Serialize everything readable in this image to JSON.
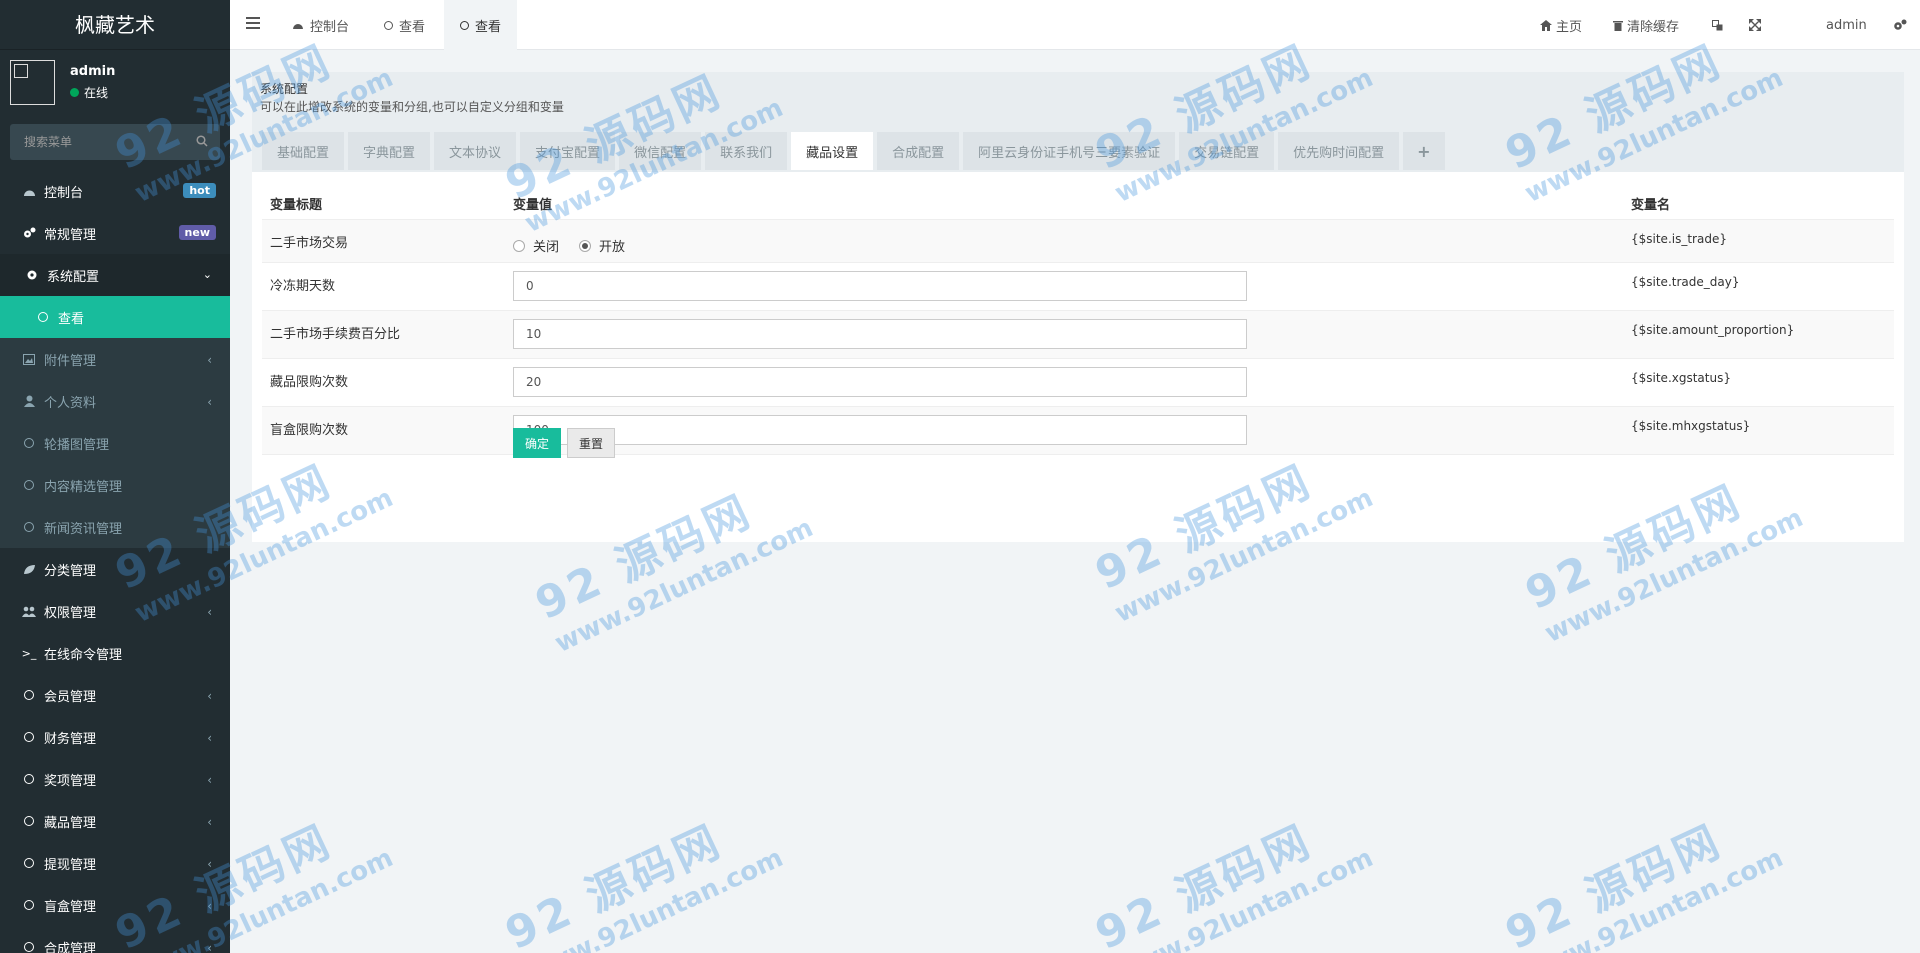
{
  "app": {
    "title": "枫藏艺术"
  },
  "user": {
    "name": "admin",
    "status": "在线"
  },
  "search": {
    "placeholder": "搜索菜单"
  },
  "sidebar": {
    "items": [
      {
        "label": "控制台",
        "badge": "hot"
      },
      {
        "label": "常规管理",
        "badge": "new"
      },
      {
        "label": "系统配置"
      },
      {
        "label": "查看"
      },
      {
        "label": "附件管理"
      },
      {
        "label": "个人资料"
      },
      {
        "label": "轮播图管理"
      },
      {
        "label": "内容精选管理"
      },
      {
        "label": "新闻资讯管理"
      },
      {
        "label": "分类管理"
      },
      {
        "label": "权限管理"
      },
      {
        "label": "在线命令管理"
      },
      {
        "label": "会员管理"
      },
      {
        "label": "财务管理"
      },
      {
        "label": "奖项管理"
      },
      {
        "label": "藏品管理"
      },
      {
        "label": "提现管理"
      },
      {
        "label": "盲盒管理"
      },
      {
        "label": "合成管理"
      }
    ]
  },
  "header": {
    "tabs": [
      {
        "label": "控制台"
      },
      {
        "label": "查看"
      },
      {
        "label": "查看"
      }
    ],
    "home": "主页",
    "clear_cache": "清除缓存",
    "user": "admin"
  },
  "panel": {
    "title": "系统配置",
    "description": "可以在此增改系统的变量和分组,也可以自定义分组和变量",
    "tabs": [
      "基础配置",
      "字典配置",
      "文本协议",
      "支付宝配置",
      "微信配置",
      "联系我们",
      "藏品设置",
      "合成配置",
      "阿里云身份证手机号三要素验证",
      "交易链配置",
      "优先购时间配置"
    ],
    "active_tab": "藏品设置",
    "add_tab_symbol": "+"
  },
  "table": {
    "headers": {
      "title": "变量标题",
      "value": "变量值",
      "name": "变量名"
    },
    "rows": [
      {
        "title": "二手市场交易",
        "var": "{$site.is_trade}",
        "radio_off": "关闭",
        "radio_on": "开放",
        "selected": "开放"
      },
      {
        "title": "冷冻期天数",
        "value": "0",
        "var": "{$site.trade_day}"
      },
      {
        "title": "二手市场手续费百分比",
        "value": "10",
        "var": "{$site.amount_proportion}"
      },
      {
        "title": "藏品限购次数",
        "value": "20",
        "var": "{$site.xgstatus}"
      },
      {
        "title": "盲盒限购次数",
        "value": "100",
        "var": "{$site.mhxgstatus}"
      }
    ]
  },
  "buttons": {
    "submit": "确定",
    "reset": "重置"
  },
  "watermark": {
    "text": "92 源码网",
    "url": "www.92luntan.com"
  },
  "colors": {
    "sidebar_bg": "#222d32",
    "accent": "#18bc9c",
    "hot_badge": "#3c8dbc",
    "new_badge": "#605ca8",
    "online": "#00a65a"
  }
}
